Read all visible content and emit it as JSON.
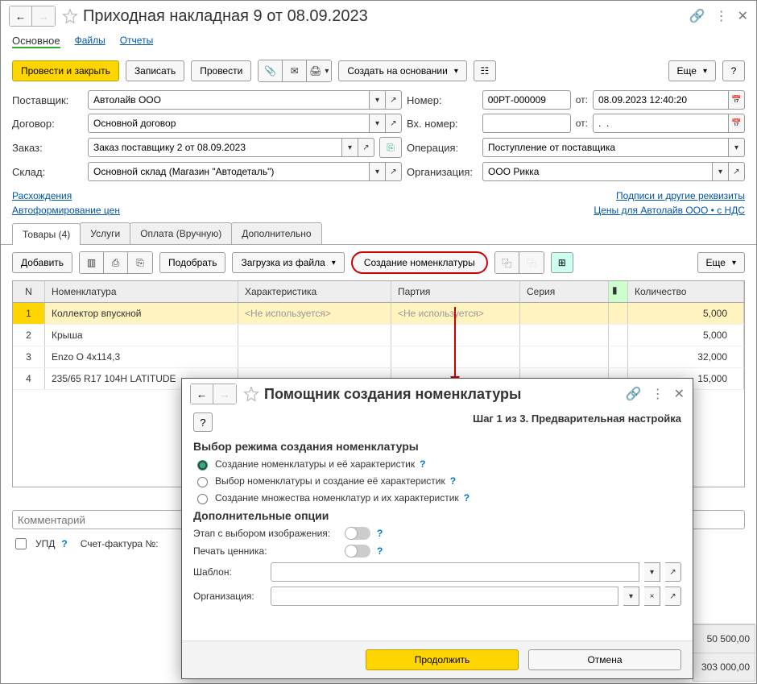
{
  "window": {
    "title": "Приходная накладная 9 от 08.09.2023"
  },
  "mainTabs": {
    "main": "Основное",
    "files": "Файлы",
    "reports": "Отчеты"
  },
  "toolbar": {
    "post_close": "Провести и закрыть",
    "save": "Записать",
    "post": "Провести",
    "based_on": "Создать на основании",
    "more": "Еще",
    "help": "?"
  },
  "form": {
    "supplier_label": "Поставщик:",
    "supplier": "Автолайв ООО",
    "number_label": "Номер:",
    "number": "00РТ-000009",
    "from_label": "от:",
    "date": "08.09.2023 12:40:20",
    "contract_label": "Договор:",
    "contract": "Основной договор",
    "in_number_label": "Вх. номер:",
    "in_number": "",
    "in_date": ".  .",
    "order_label": "Заказ:",
    "order": "Заказ поставщику 2 от 08.09.2023",
    "operation_label": "Операция:",
    "operation": "Поступление от поставщика",
    "warehouse_label": "Склад:",
    "warehouse": "Основной склад (Магазин \"Автодеталь\")",
    "org_label": "Организация:",
    "org": "ООО Рикка"
  },
  "links": {
    "discrep": "Расхождения",
    "sign": "Подписи и другие реквизиты",
    "autoprice": "Автоформирование цен",
    "prices": "Цены для Автолайв ООО • с НДС"
  },
  "innerTabs": {
    "goods": "Товары (4)",
    "services": "Услуги",
    "payment": "Оплата (Вручную)",
    "additional": "Дополнительно"
  },
  "itoolbar": {
    "add": "Добавить",
    "pick": "Подобрать",
    "load": "Загрузка из файла",
    "create_nom": "Создание номенклатуры",
    "more": "Еще"
  },
  "grid": {
    "headers": {
      "n": "N",
      "nom": "Номенклатура",
      "char": "Характеристика",
      "part": "Партия",
      "ser": "Серия",
      "qty": "Количество"
    },
    "rows": [
      {
        "n": "1",
        "nom": "Коллектор впускной",
        "char": "<Не используется>",
        "part": "<Не используется>",
        "qty": "5,000"
      },
      {
        "n": "2",
        "nom": "Крыша",
        "char": "",
        "part": "",
        "qty": "5,000"
      },
      {
        "n": "3",
        "nom": "Enzo O 4x114,3",
        "char": "",
        "part": "",
        "qty": "32,000"
      },
      {
        "n": "4",
        "nom": "235/65 R17 104H LATITUDE",
        "char": "",
        "part": "",
        "qty": "15,000"
      }
    ]
  },
  "footer": {
    "comment_ph": "Комментарий",
    "upd": "УПД",
    "invoice_lbl": "Счет-фактура №:",
    "total1": "50 500,00",
    "total2": "303 000,00"
  },
  "modal": {
    "title": "Помощник создания номенклатуры",
    "step": "Шаг 1 из 3. Предварительная настройка",
    "sec1": "Выбор режима создания номенклатуры",
    "r1": "Создание номенклатуры и её характеристик",
    "r2": "Выбор номенклатуры и создание её характеристик",
    "r3": "Создание множества номенклатур и их характеристик",
    "sec2": "Дополнительные опции",
    "opt1": "Этап с выбором изображения:",
    "opt2": "Печать ценника:",
    "template_lbl": "Шаблон:",
    "org_lbl": "Организация:",
    "continue": "Продолжить",
    "cancel": "Отмена",
    "help": "?"
  }
}
